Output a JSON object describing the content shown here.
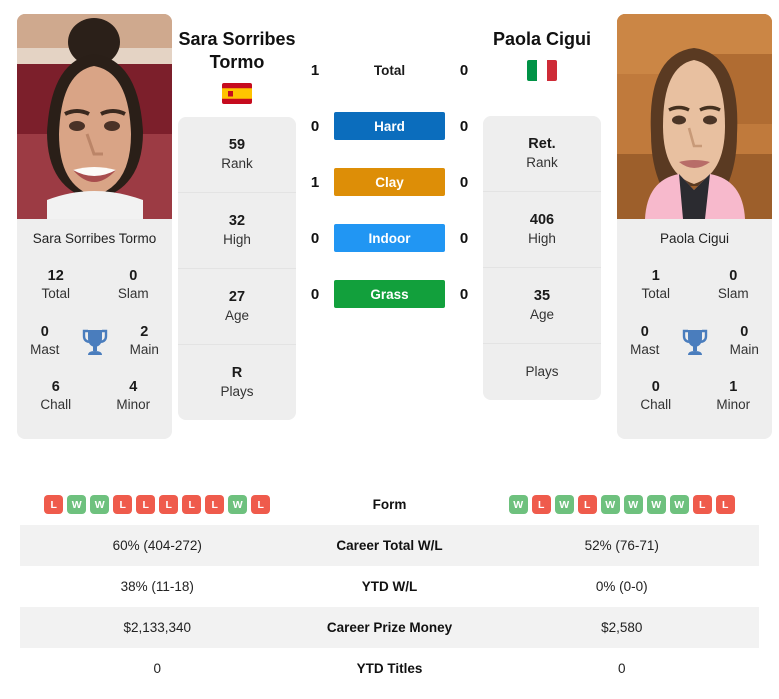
{
  "players": {
    "left": {
      "name": "Sara Sorribes Tormo",
      "name_card": "Sara Sorribes Tormo",
      "flag": "spain-flag",
      "info": [
        {
          "value": "59",
          "label": "Rank"
        },
        {
          "value": "32",
          "label": "High"
        },
        {
          "value": "27",
          "label": "Age"
        },
        {
          "value": "R",
          "label": "Plays"
        }
      ],
      "titles": [
        {
          "value": "12",
          "label": "Total"
        },
        {
          "value": "0",
          "label": "Slam"
        },
        {
          "value": "0",
          "label": "Mast"
        },
        {
          "value": "2",
          "label": "Main"
        },
        {
          "value": "6",
          "label": "Chall"
        },
        {
          "value": "4",
          "label": "Minor"
        }
      ],
      "form": [
        "L",
        "W",
        "W",
        "L",
        "L",
        "L",
        "L",
        "L",
        "W",
        "L"
      ],
      "career_total_wl": "60% (404-272)",
      "ytd_wl": "38% (11-18)",
      "career_prize_money": "$2,133,340",
      "ytd_titles": "0"
    },
    "right": {
      "name": "Paola Cigui",
      "name_card": "Paola Cigui",
      "flag": "italy-flag",
      "info": [
        {
          "value": "Ret.",
          "label": "Rank"
        },
        {
          "value": "406",
          "label": "High"
        },
        {
          "value": "35",
          "label": "Age"
        },
        {
          "value": "",
          "label": "Plays"
        }
      ],
      "titles": [
        {
          "value": "1",
          "label": "Total"
        },
        {
          "value": "0",
          "label": "Slam"
        },
        {
          "value": "0",
          "label": "Mast"
        },
        {
          "value": "0",
          "label": "Main"
        },
        {
          "value": "0",
          "label": "Chall"
        },
        {
          "value": "1",
          "label": "Minor"
        }
      ],
      "form": [
        "W",
        "L",
        "W",
        "L",
        "W",
        "W",
        "W",
        "W",
        "L",
        "L"
      ],
      "career_total_wl": "52% (76-71)",
      "ytd_wl": "0% (0-0)",
      "career_prize_money": "$2,580",
      "ytd_titles": "0"
    }
  },
  "head_to_head": [
    {
      "label": "Total",
      "left": "1",
      "right": "0",
      "color": "",
      "plain": true
    },
    {
      "label": "Hard",
      "left": "0",
      "right": "0",
      "color": "#0b6dbd",
      "plain": false
    },
    {
      "label": "Clay",
      "left": "1",
      "right": "0",
      "color": "#dd8e07",
      "plain": false
    },
    {
      "label": "Indoor",
      "left": "0",
      "right": "0",
      "color": "#2196f3",
      "plain": false
    },
    {
      "label": "Grass",
      "left": "0",
      "right": "0",
      "color": "#12a03c",
      "plain": false
    }
  ],
  "table_rows": [
    {
      "label": "Form",
      "type": "form"
    },
    {
      "label": "Career Total W/L",
      "type": "text",
      "key": "career_total_wl"
    },
    {
      "label": "YTD W/L",
      "type": "text",
      "key": "ytd_wl"
    },
    {
      "label": "Career Prize Money",
      "type": "text",
      "key": "career_prize_money"
    },
    {
      "label": "YTD Titles",
      "type": "text",
      "key": "ytd_titles"
    }
  ],
  "colors": {
    "win": "#6ec17e",
    "loss": "#ef5b4c",
    "card_bg": "#eeeeee",
    "row_alt": "#f2f2f2",
    "trophy": "#4a7dbd"
  }
}
